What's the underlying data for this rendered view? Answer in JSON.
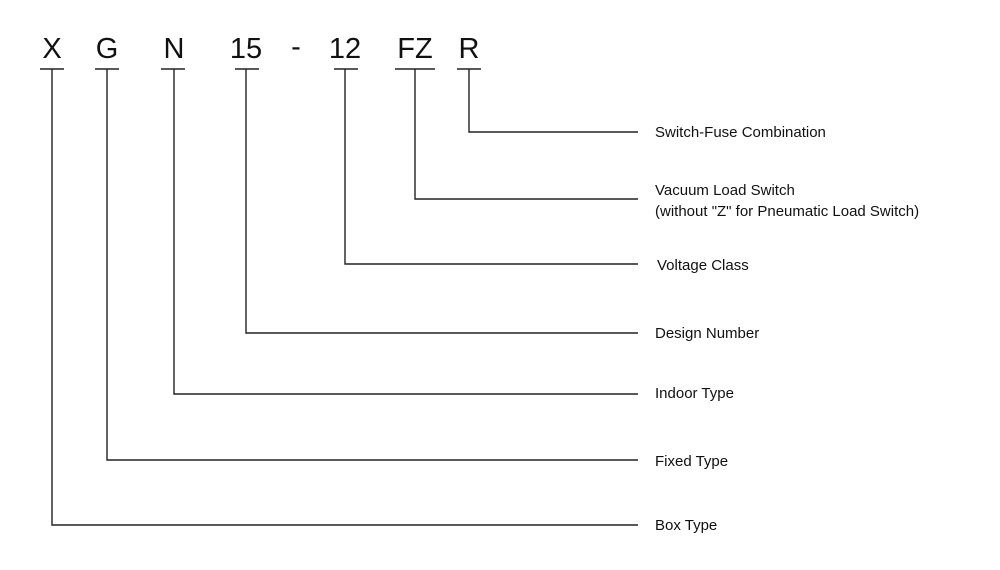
{
  "diagram": {
    "code_parts": [
      {
        "text": "X",
        "label": "Box Type"
      },
      {
        "text": "G",
        "label": "Fixed Type"
      },
      {
        "text": "N",
        "label": "Indoor Type"
      },
      {
        "text": "15",
        "label": "Design Number"
      },
      {
        "text": "12",
        "label": "Voltage Class"
      },
      {
        "text": "FZ",
        "label": "Vacuum Load Switch",
        "label_line2": "(without \"Z\" for Pneumatic Load Switch)"
      },
      {
        "text": "R",
        "label": "Switch-Fuse Combination"
      }
    ],
    "separator": "-"
  }
}
